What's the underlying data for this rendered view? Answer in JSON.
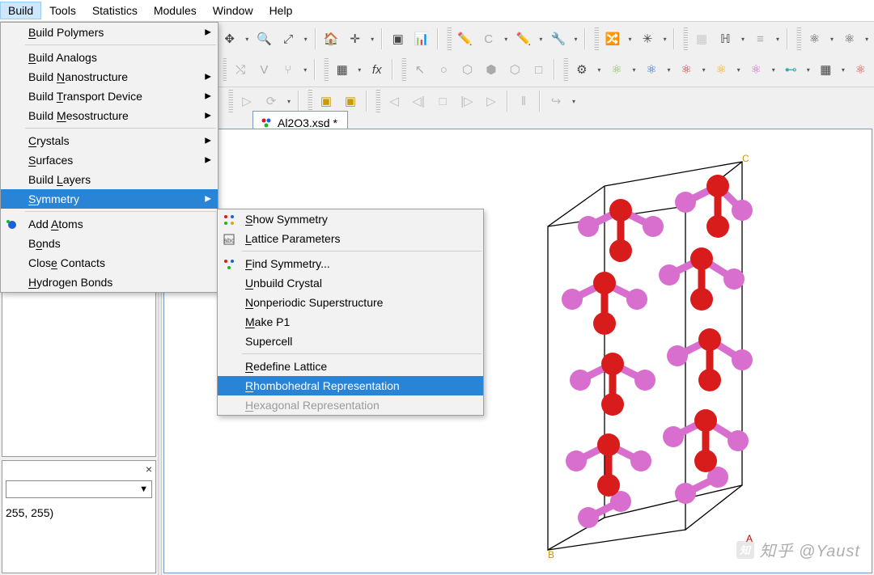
{
  "menubar": {
    "build": "Build",
    "tools": "Tools",
    "statistics": "Statistics",
    "modules": "Modules",
    "window": "Window",
    "help": "Help"
  },
  "build_menu": {
    "build_polymers": "Build Polymers",
    "build_analogs": "Build Analogs",
    "build_nano": "Build Nanostructure",
    "build_transport": "Build Transport Device",
    "build_meso": "Build Mesostructure",
    "crystals": "Crystals",
    "surfaces": "Surfaces",
    "build_layers": "Build Layers",
    "symmetry": "Symmetry",
    "add_atoms": "Add Atoms",
    "bonds": "Bonds",
    "close_contacts": "Close Contacts",
    "hydrogen_bonds": "Hydrogen Bonds"
  },
  "sym_menu": {
    "show_sym": "Show Symmetry",
    "lattice_params": "Lattice Parameters",
    "find_sym": "Find Symmetry...",
    "unbuild": "Unbuild Crystal",
    "nonperiodic": "Nonperiodic Superstructure",
    "make_p1": "Make P1",
    "supercell": "Supercell",
    "redefine": "Redefine Lattice",
    "rhombo": "Rhombohedral Representation",
    "hex": "Hexagonal Representation"
  },
  "document": {
    "tab_title": "Al2O3.xsd *"
  },
  "left_panel": {
    "rgb_row": "255, 255)"
  },
  "watermark": {
    "text": "知乎 @Yaust"
  },
  "colors": {
    "highlight": "#2a84d6",
    "atom_al": "#d86fcf",
    "atom_o": "#d81b1b"
  }
}
